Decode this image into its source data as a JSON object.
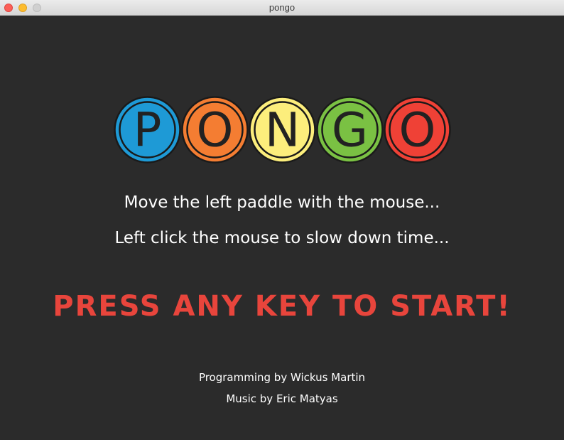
{
  "window": {
    "title": "pongo"
  },
  "logo": {
    "letters": [
      {
        "char": "P",
        "color": "#1e9ad6"
      },
      {
        "char": "O",
        "color": "#f47d32"
      },
      {
        "char": "N",
        "color": "#fcee7c"
      },
      {
        "char": "G",
        "color": "#7ac143"
      },
      {
        "char": "O",
        "color": "#ef4136"
      }
    ]
  },
  "instructions": {
    "line1": "Move the left paddle with the mouse...",
    "line2": "Left click the mouse to slow down time..."
  },
  "prompt": {
    "start": "PRESS ANY KEY TO START!"
  },
  "credits": {
    "programming": "Programming by Wickus Martin",
    "music": "Music by Eric Matyas"
  },
  "colors": {
    "background": "#2b2b2b",
    "prompt": "#e8453c",
    "text": "#ffffff"
  }
}
